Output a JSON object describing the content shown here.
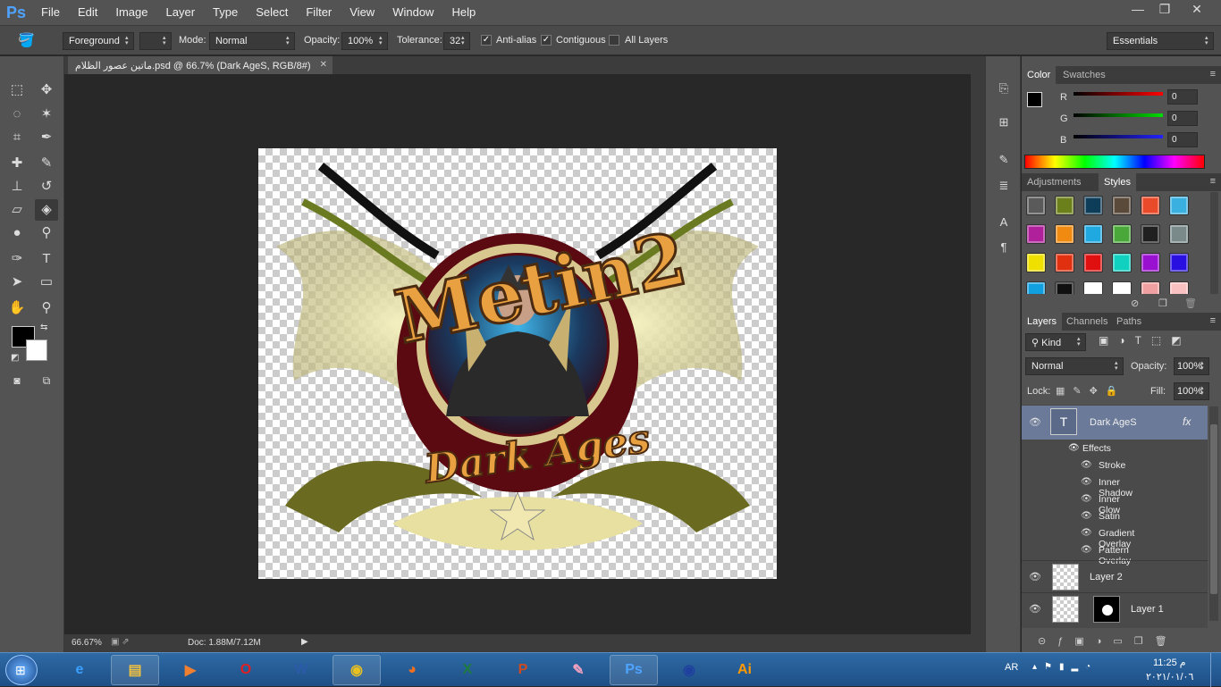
{
  "app": {
    "logo": "Ps"
  },
  "menu": [
    "File",
    "Edit",
    "Image",
    "Layer",
    "Type",
    "Select",
    "Filter",
    "View",
    "Window",
    "Help"
  ],
  "window_controls": {
    "minimize": "—",
    "restore": "❐",
    "close": "✕"
  },
  "options": {
    "fill_source": "Foreground",
    "mode_label": "Mode:",
    "mode_value": "Normal",
    "opacity_label": "Opacity:",
    "opacity_value": "100%",
    "tolerance_label": "Tolerance:",
    "tolerance_value": "32",
    "antialias_label": "Anti-alias",
    "antialias_checked": true,
    "contiguous_label": "Contiguous",
    "contiguous_checked": true,
    "alllayers_label": "All Layers",
    "alllayers_checked": false,
    "workspace": "Essentials"
  },
  "document": {
    "tab_title": "ماتین عصور الظلام.psd @ 66.7% (Dark AgeS, RGB/8#)",
    "tab_close": "✕",
    "zoom": "66.67%",
    "doc_size": "Doc: 1.88M/7.12M"
  },
  "artwork": {
    "logo_text_top": "Metin2",
    "logo_text_bottom": "Dark Ages"
  },
  "color_panel": {
    "tabs": [
      "Color",
      "Swatches"
    ],
    "channels": [
      {
        "label": "R",
        "value": "0",
        "color": "#e02020"
      },
      {
        "label": "G",
        "value": "0",
        "color": "#20c020"
      },
      {
        "label": "B",
        "value": "0",
        "color": "#2040e0"
      }
    ]
  },
  "styles_panel": {
    "tabs": [
      "Adjustments",
      "Styles"
    ],
    "swatches": [
      "#5a5a5a",
      "#6b7f1a",
      "#0e3d5a",
      "#5a4a3a",
      "#e84a2a",
      "#3ab0e0",
      "#b0209a",
      "#f08a10",
      "#20a8e0",
      "#4aa83a",
      "#202020",
      "#7a8a8a",
      "#f0e000",
      "#e03010",
      "#e01010",
      "#10d0c0",
      "#9a10d0",
      "#2a10e0",
      "#10a0e0",
      "#101010",
      "#ffffff",
      "#ffffff",
      "#f0a0a0",
      "#f8c0c0"
    ]
  },
  "layers_panel": {
    "tabs": [
      "Layers",
      "Channels",
      "Paths"
    ],
    "kind_label": "Kind",
    "blend_mode": "Normal",
    "opacity_label": "Opacity:",
    "opacity_value": "100%",
    "lock_label": "Lock:",
    "fill_label": "Fill:",
    "fill_value": "100%",
    "layers": [
      {
        "name": "Dark AgeS",
        "fx": "fx",
        "effects_label": "Effects",
        "effects": [
          "Stroke",
          "Inner Shadow",
          "Inner Glow",
          "Satin",
          "Gradient Overlay",
          "Pattern Overlay"
        ]
      },
      {
        "name": "Layer 2"
      },
      {
        "name": "Layer 1"
      }
    ]
  },
  "taskbar": {
    "lang": "AR",
    "time": "11:25 م",
    "date": "٢٠٢١/٠١/٠٦",
    "apps": [
      {
        "name": "ie",
        "glyph": "e",
        "color": "#3aa0ff",
        "open": false
      },
      {
        "name": "explorer",
        "glyph": "▤",
        "color": "#f0c040",
        "open": true
      },
      {
        "name": "media",
        "glyph": "▶",
        "color": "#f08030",
        "open": false
      },
      {
        "name": "opera",
        "glyph": "O",
        "color": "#e02020",
        "open": false
      },
      {
        "name": "word",
        "glyph": "W",
        "color": "#2a5aa8",
        "open": false
      },
      {
        "name": "chrome",
        "glyph": "◉",
        "color": "#e8c020",
        "open": true
      },
      {
        "name": "firefox",
        "glyph": "◕",
        "color": "#f07020",
        "open": false
      },
      {
        "name": "excel",
        "glyph": "X",
        "color": "#1f7a40",
        "open": false
      },
      {
        "name": "powerpoint",
        "glyph": "P",
        "color": "#d04a20",
        "open": false
      },
      {
        "name": "paint",
        "glyph": "✎",
        "color": "#f0a0c0",
        "open": false
      },
      {
        "name": "photoshop",
        "glyph": "Ps",
        "color": "#4fa3ff",
        "open": true
      },
      {
        "name": "eye-app",
        "glyph": "◉",
        "color": "#2040a0",
        "open": false
      },
      {
        "name": "illustrator",
        "glyph": "Ai",
        "color": "#ff9a00",
        "open": false
      }
    ]
  }
}
